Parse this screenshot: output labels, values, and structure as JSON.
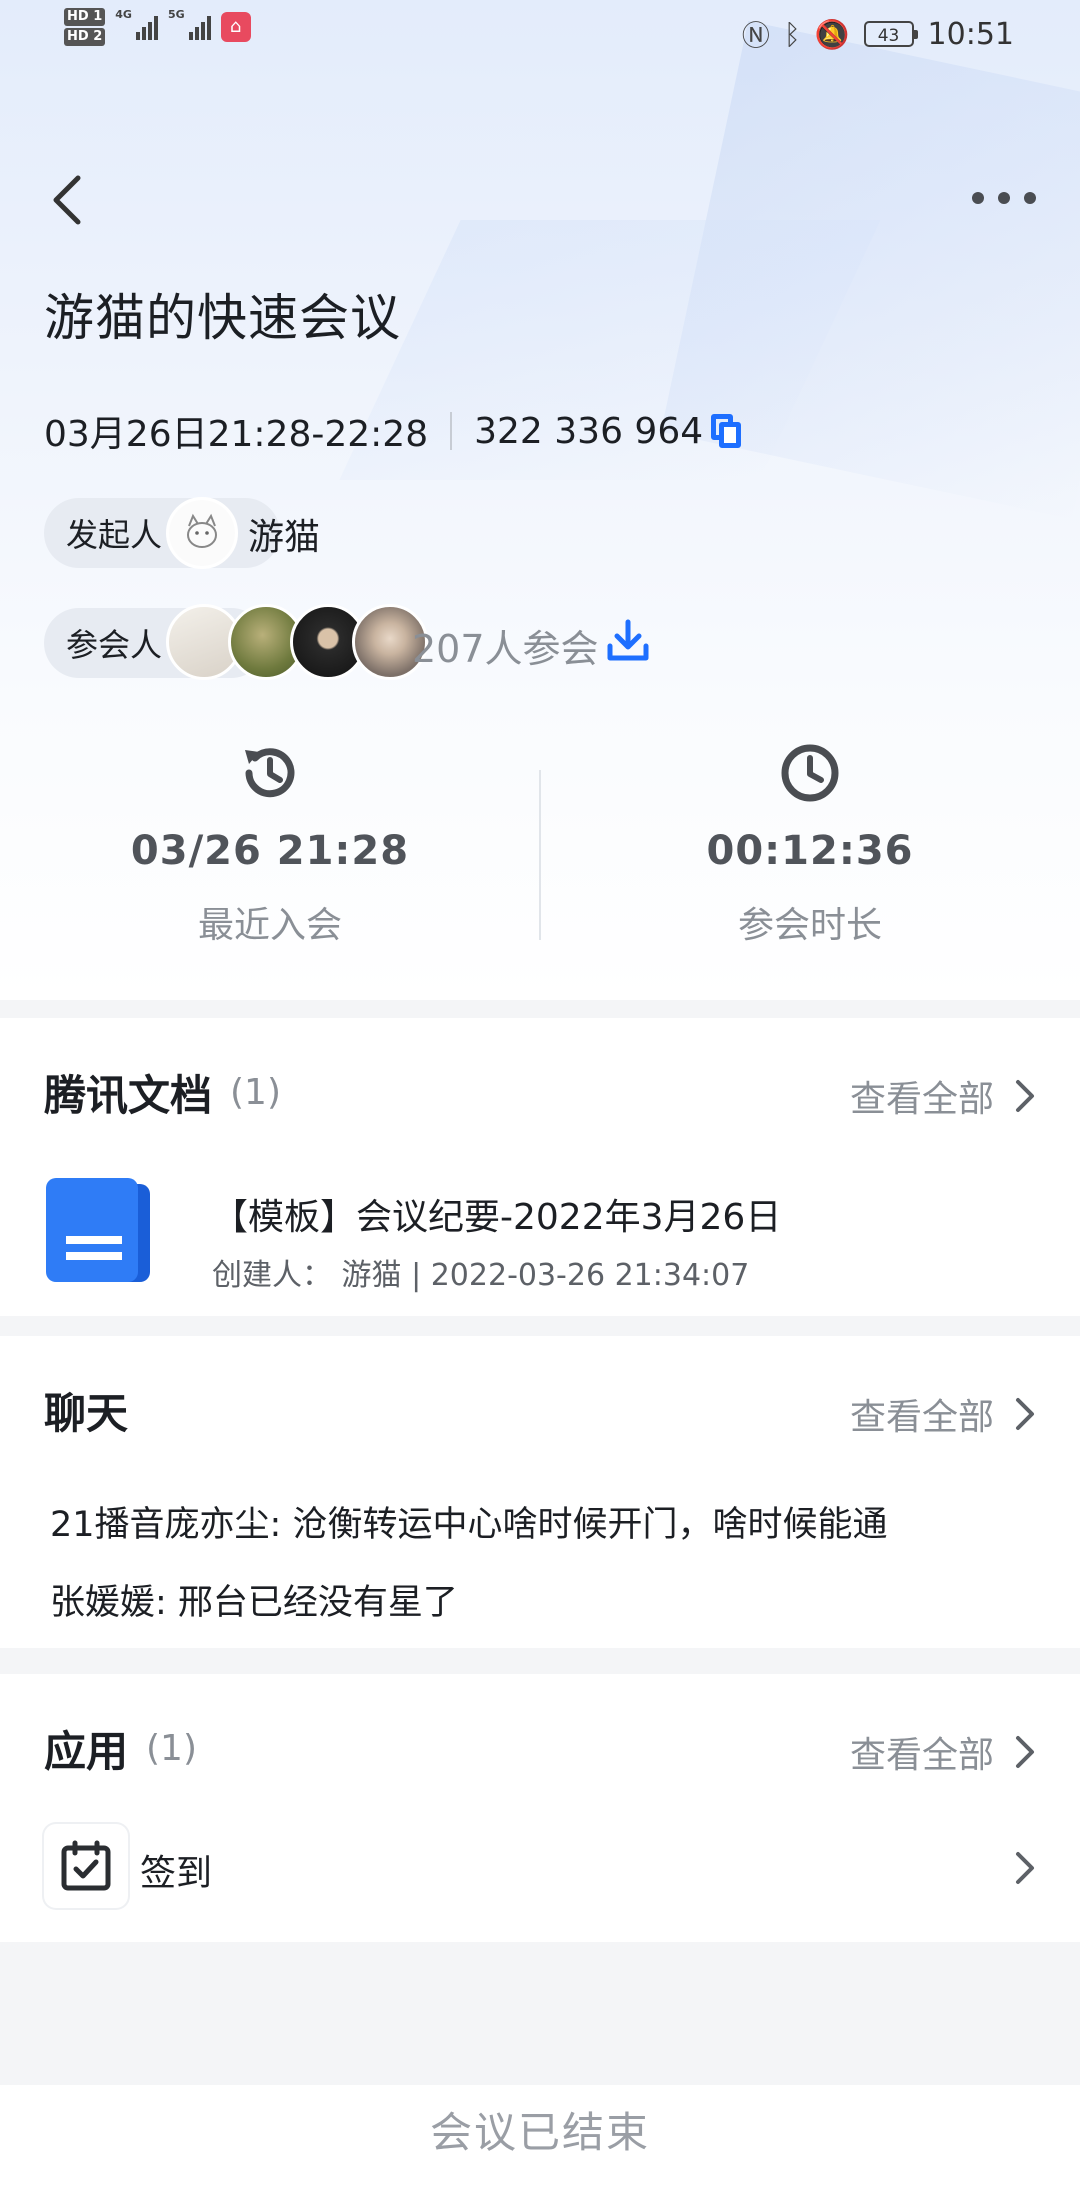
{
  "status_bar": {
    "hd1": "HD 1",
    "hd2": "HD 2",
    "net1": "4G",
    "net2": "5G",
    "battery": "43",
    "time": "10:51"
  },
  "header": {
    "title": "游猫的快速会议",
    "time_range": "03月26日21:28-22:28",
    "meeting_id": "322 336 964"
  },
  "initiator": {
    "label": "发起人",
    "name": "游猫"
  },
  "participants": {
    "label": "参会人",
    "count_text": "207人参会"
  },
  "stats": [
    {
      "value": "03/26 21:28",
      "caption": "最近入会",
      "icon": "history-clock-icon"
    },
    {
      "value": "00:12:36",
      "caption": "参会时长",
      "icon": "clock-icon"
    }
  ],
  "docs": {
    "title": "腾讯文档",
    "count": "(1)",
    "view_all": "查看全部",
    "item": {
      "title": "【模板】会议纪要-2022年3月26日",
      "meta": "创建人：  游猫 | 2022-03-26 21:34:07"
    }
  },
  "chat": {
    "title": "聊天",
    "view_all": "查看全部",
    "messages": [
      "21播音庞亦尘: 沧衡转运中心啥时候开门，啥时候能通",
      "张媛媛: 邢台已经没有星了"
    ]
  },
  "apps": {
    "title": "应用",
    "count": "(1)",
    "view_all": "查看全部",
    "item": "签到"
  },
  "footer": {
    "text": "会议已结束"
  },
  "colors": {
    "accent": "#1e6fff",
    "muted": "#8a8f96",
    "text": "#1c1f24"
  }
}
